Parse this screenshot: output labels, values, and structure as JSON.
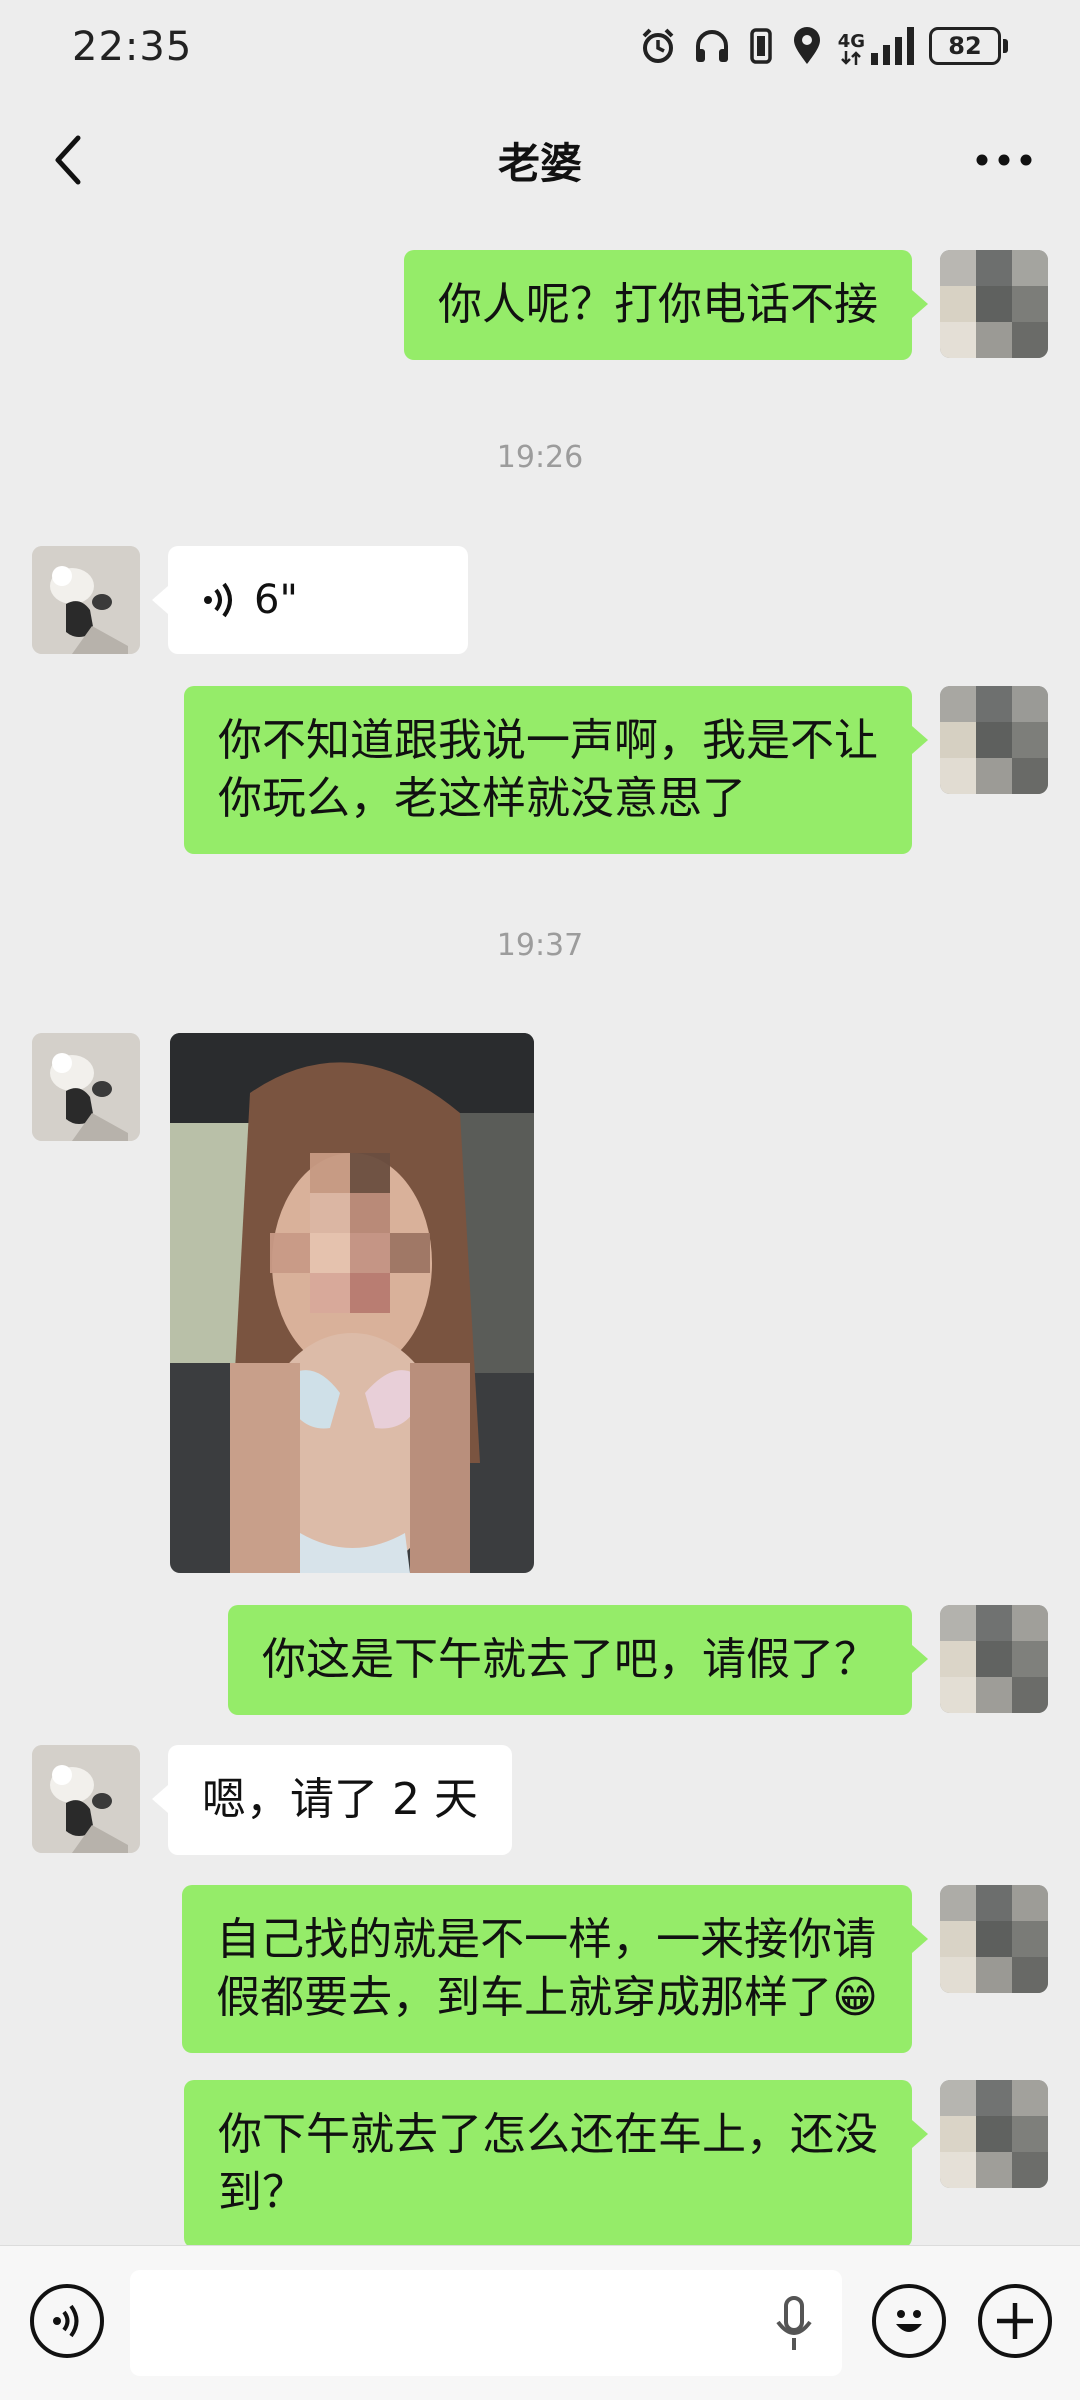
{
  "status_bar": {
    "time": "22:35",
    "network": "4G",
    "battery": "82",
    "icons": [
      "alarm-icon",
      "headphones-icon",
      "vibrate-icon",
      "location-icon",
      "signal-icon",
      "battery-icon"
    ]
  },
  "header": {
    "title": "老婆",
    "back_icon": "chevron-left-icon",
    "more_icon": "more-dots-icon"
  },
  "messages": [
    {
      "from": "me",
      "type": "text",
      "text": "你人呢？打你电话不接"
    },
    {
      "type": "timestamp",
      "text": "19:26"
    },
    {
      "from": "her",
      "type": "voice",
      "duration": "6\""
    },
    {
      "from": "me",
      "type": "text",
      "lines": [
        "你不知道跟我说一声啊，我是不让",
        "你玩么，老这样就没意思了"
      ]
    },
    {
      "type": "timestamp",
      "text": "19:37"
    },
    {
      "from": "her",
      "type": "image",
      "description": "pixelated-photo"
    },
    {
      "from": "me",
      "type": "text",
      "text": "你这是下午就去了吧，请假了？"
    },
    {
      "from": "her",
      "type": "text",
      "text": "嗯，请了 2 天"
    },
    {
      "from": "me",
      "type": "text",
      "lines": [
        "自己找的就是不一样，一来接你请",
        "假都要去，到车上就穿成那样了😁"
      ]
    },
    {
      "from": "me",
      "type": "text",
      "lines": [
        "你下午就去了怎么还在车上，还没",
        "到？"
      ]
    }
  ],
  "input_bar": {
    "voice_icon": "voice-mode-icon",
    "placeholder": "",
    "mic_icon": "microphone-icon",
    "emoji_icon": "emoji-icon",
    "plus_icon": "plus-icon"
  },
  "colors": {
    "background": "#ededed",
    "my_bubble": "#95ec69",
    "her_bubble": "#ffffff",
    "timestamp_text": "#9c9c9c"
  }
}
